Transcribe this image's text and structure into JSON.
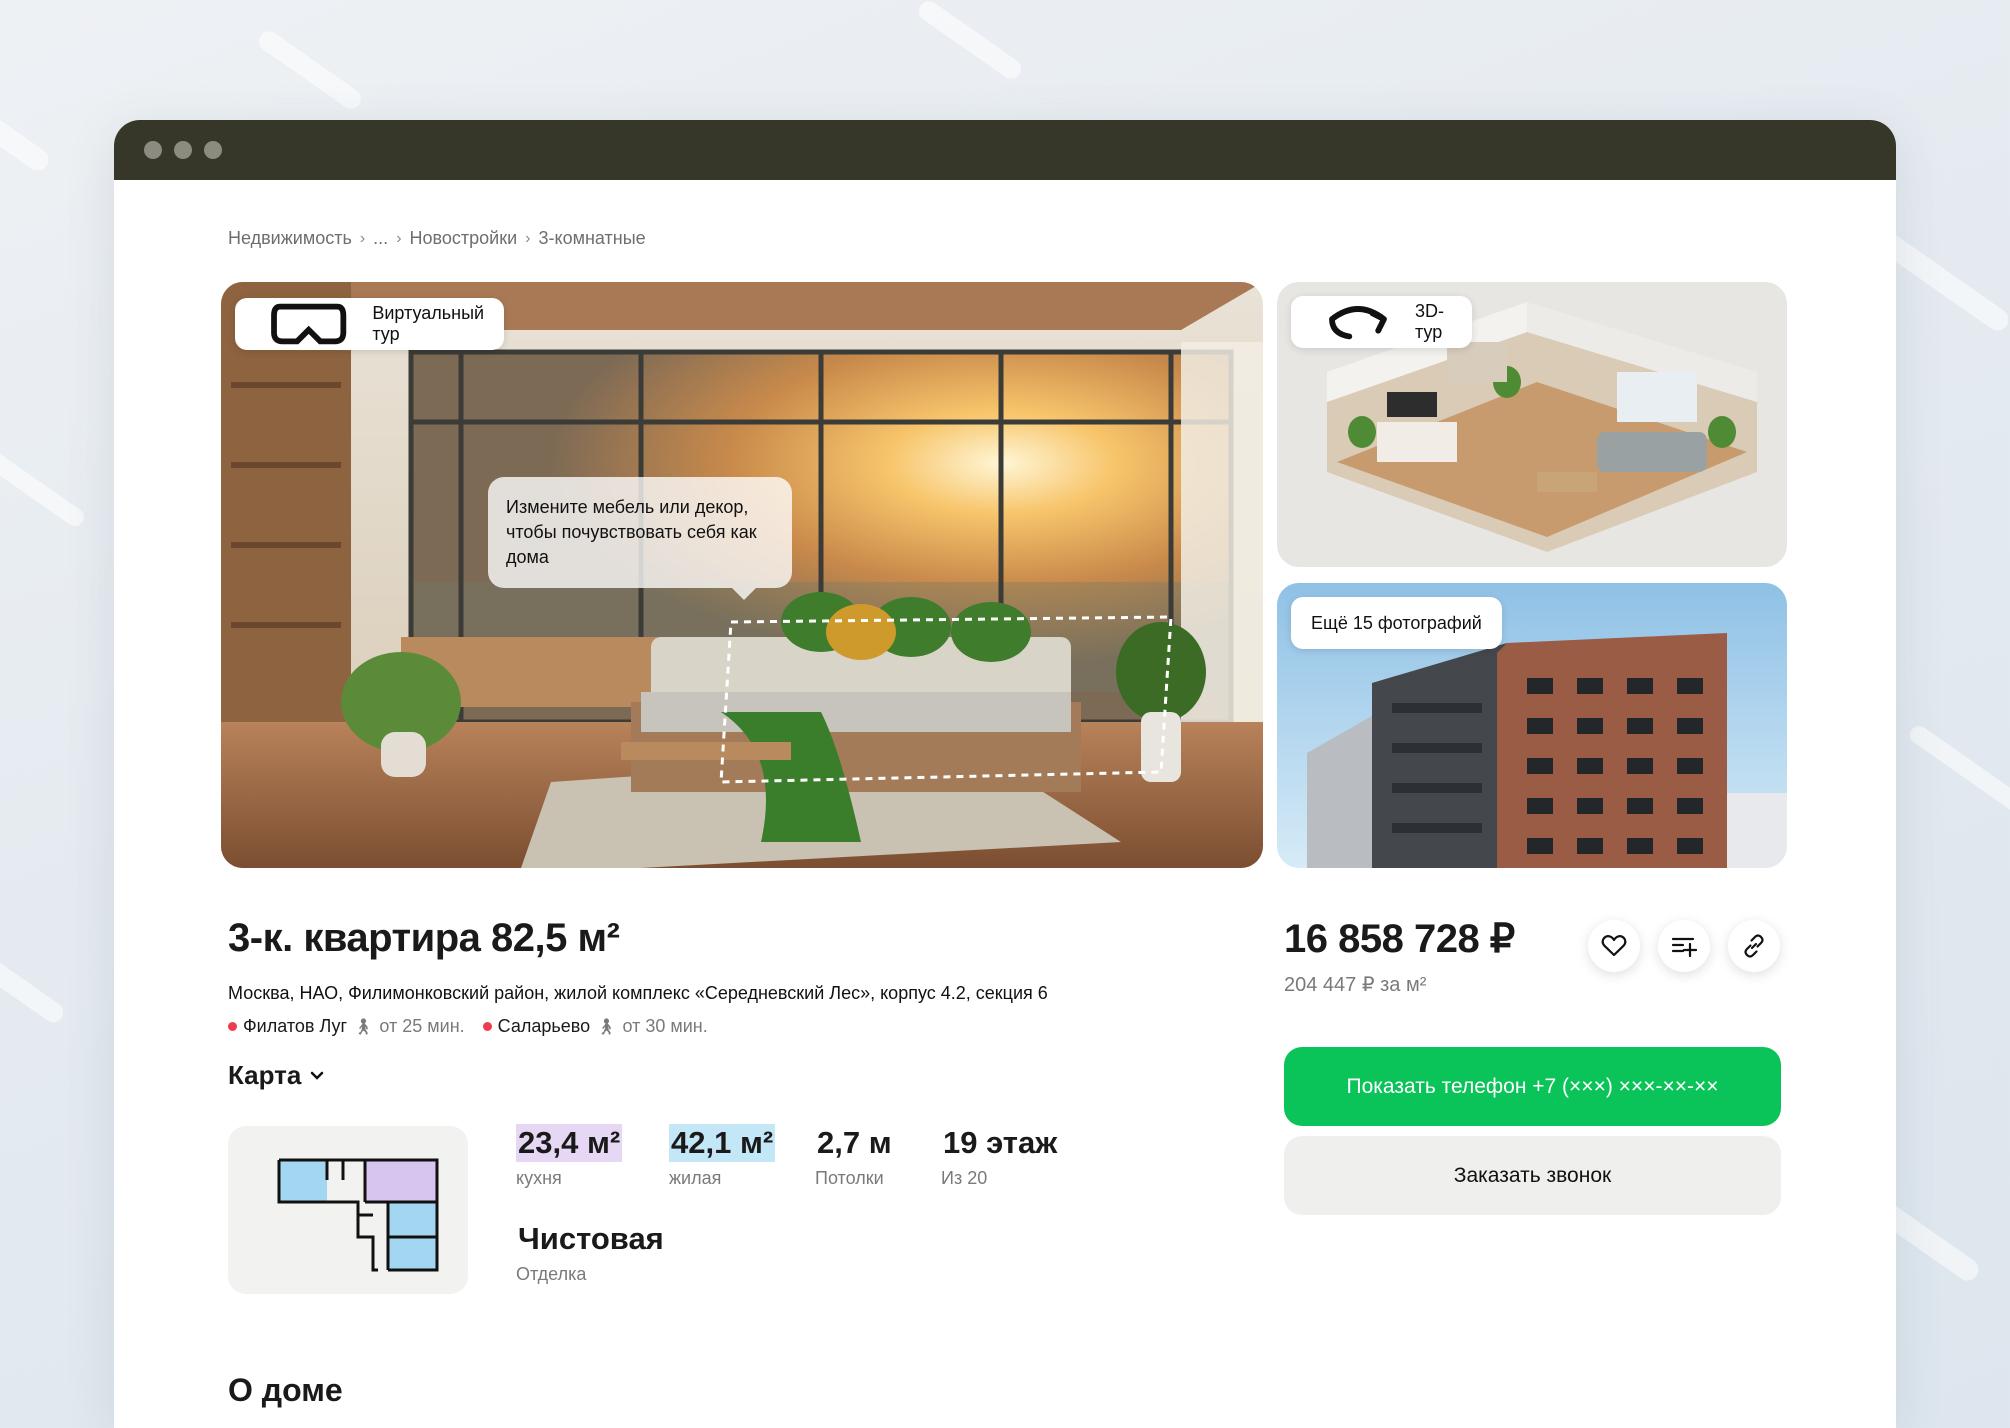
{
  "breadcrumb": {
    "items": [
      "Недвижимость",
      "...",
      "Новостройки",
      "3-комнатные"
    ],
    "separator": "›"
  },
  "gallery": {
    "virtual_tour_label": "Виртуальный тур",
    "tooltip": "Измените мебель или декор, чтобы почувствовать себя как дома",
    "tour_3d_label": "3D-тур",
    "more_photos_label": "Ещё 15 фотографий"
  },
  "listing": {
    "title": "3-к. квартира 82,5 м²",
    "address": "Москва, НАО, Филимонковский район, жилой комплекс «Середневский Лес», корпус 4.2, секция 6",
    "metro": [
      {
        "station": "Филатов Луг",
        "time": "от 25 мин.",
        "color": "#ef3b4f"
      },
      {
        "station": "Саларьево",
        "time": "от 30 мин.",
        "color": "#ef3b4f"
      }
    ],
    "map_label": "Карта"
  },
  "stats": {
    "kitchen": {
      "value": "23,4 м²",
      "label": "кухня",
      "highlight": "#e6d8f5"
    },
    "living": {
      "value": "42,1 м²",
      "label": "жилая",
      "highlight": "#c3e7f7"
    },
    "ceilings": {
      "value": "2,7 м",
      "label": "Потолки"
    },
    "floor": {
      "value": "19 этаж",
      "label": "Из 20"
    },
    "finish": {
      "value": "Чистовая",
      "label": "Отделка"
    }
  },
  "price": {
    "total": "16 858 728 ₽",
    "per_sqm": "204 447 ₽ за м²"
  },
  "actions": {
    "favorite_icon": "heart-icon",
    "compare_icon": "compare-list-icon",
    "share_icon": "link-icon",
    "show_phone": "Показать телефон +7 (×××) ×××-××-××",
    "order_call": "Заказать звонок",
    "primary_color": "#0ac45a"
  },
  "sections": {
    "about_house": "О доме"
  }
}
